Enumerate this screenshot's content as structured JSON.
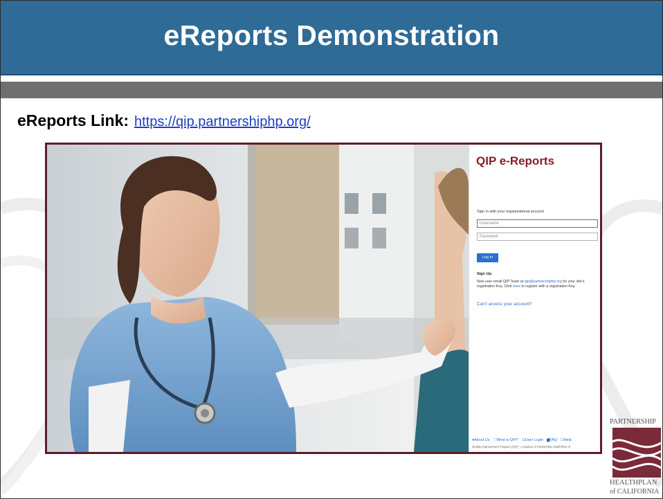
{
  "slide": {
    "title": "eReports Demonstration",
    "link_label": "eReports Link:",
    "link_url": "https://qip.partnershiphp.org/"
  },
  "login": {
    "app_title": "QIP e-Reports",
    "signin_prompt": "Sign in with your organizational account",
    "username_placeholder": "Username",
    "password_placeholder": "Password",
    "login_button": "Log In",
    "signup_heading": "Sign Up:",
    "signup_text_1": "New user email QIP Team at ",
    "signup_email": "qip@partnershiphp.org",
    "signup_text_2": " for your site's registration Key. Click ",
    "signup_here": "here",
    "signup_text_3": " to register with a registration Key.",
    "cant_access": "Can't access your account?",
    "footer_links": [
      "About Us",
      "What is QIP?",
      "User Login",
      "FAQ",
      "Help"
    ],
    "footer_note": "Quality Improvement Program (QIP) - A product of Partnership HealthPlan of"
  },
  "logo": {
    "line1": "PARTNERSHIP",
    "line2": "HEALTHPLAN",
    "line3": "of CALIFORNIA"
  },
  "colors": {
    "title_bar": "#2e6b96",
    "band": "#6f6f6f",
    "frame": "#5a1d2a",
    "qip_red": "#8a1c2b",
    "link_blue": "#1a3fbf",
    "button_blue": "#2a6fd0",
    "logo_maroon": "#7b2a3a"
  }
}
